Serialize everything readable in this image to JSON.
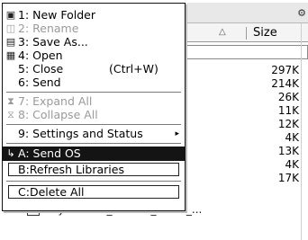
{
  "menu": {
    "items": [
      {
        "label": "1: New Folder",
        "icon": "new-folder-icon",
        "glyph": "▣",
        "enabled": true
      },
      {
        "label": "2: Rename",
        "icon": "rename-icon",
        "glyph": "◫",
        "enabled": false
      },
      {
        "label": "3: Save As...",
        "icon": "save-icon",
        "glyph": "▤",
        "enabled": true
      },
      {
        "label": "4: Open",
        "icon": "open-icon",
        "glyph": "▦",
        "enabled": true
      },
      {
        "label": "5: Close",
        "shortcut": "(Ctrl+W)",
        "enabled": true
      },
      {
        "label": "6: Send",
        "enabled": true
      },
      {
        "label": "7: Expand All",
        "icon": "expand-icon",
        "glyph": "⧗",
        "enabled": false
      },
      {
        "label": "8: Collapse All",
        "icon": "collapse-icon",
        "glyph": "⧖",
        "enabled": false
      },
      {
        "label": "9: Settings and Status",
        "submenu": true,
        "submenu_glyph": "▸",
        "enabled": true
      },
      {
        "label": "A: Send OS",
        "icon": "send-os-icon",
        "glyph": "↳",
        "enabled": true,
        "highlighted": true
      },
      {
        "label": "B:Refresh Libraries",
        "enabled": true
      },
      {
        "label": "C:Delete All",
        "enabled": true
      }
    ]
  },
  "file_list": {
    "size_header": "Size",
    "sort_indicator": "△",
    "title_icon": "⚙",
    "sizes": [
      "297K",
      "214K",
      "26K",
      "11K",
      "12K",
      "4K",
      "13K",
      "4K",
      "17K"
    ],
    "partial_row_label": "Polynomials_Factors_Roots_..."
  },
  "colors": {
    "highlight_bg": "#141414",
    "highlight_fg": "#ffffff",
    "disabled_text": "#9a9a9a"
  }
}
